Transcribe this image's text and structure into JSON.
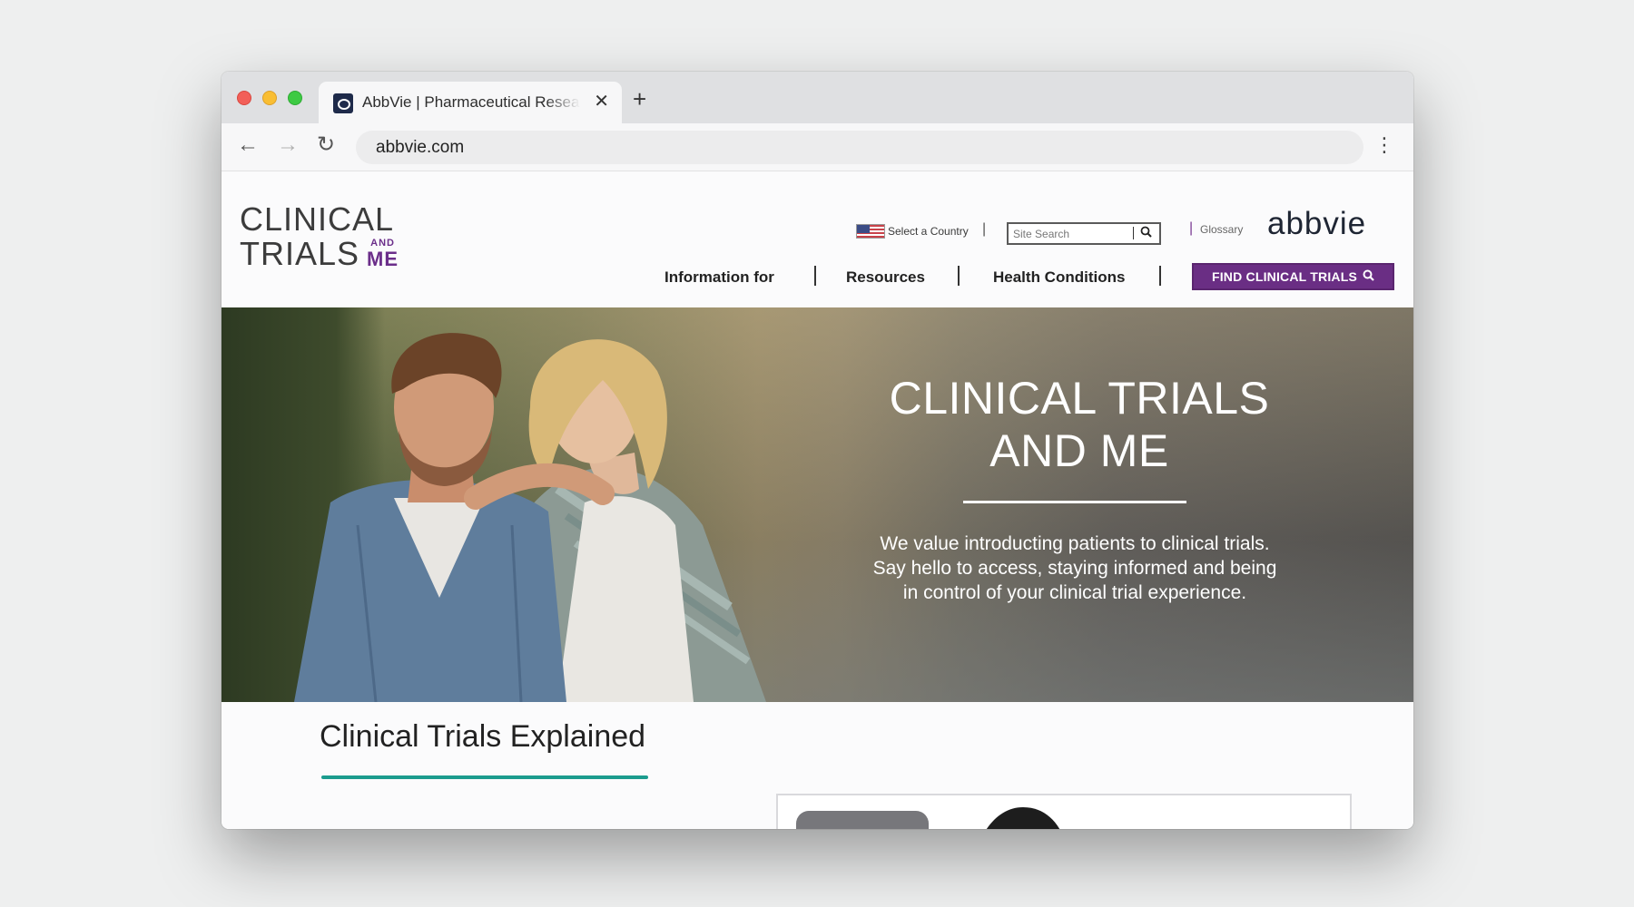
{
  "browser": {
    "tab_title": "AbbVie | Pharmaceutical Research",
    "tab_close": "✕",
    "new_tab": "+",
    "url": "abbvie.com",
    "back": "←",
    "forward": "→",
    "reload": "↻",
    "menu": "⋮"
  },
  "header": {
    "logo_line1": "CLINICAL",
    "logo_line2": "TRIALS",
    "logo_and": "AND",
    "logo_me": "ME",
    "country_label": "Select a Country",
    "search_placeholder": "Site Search",
    "glossary": "Glossary",
    "brand": "abbvie",
    "divider": "|"
  },
  "mainnav": {
    "items": [
      {
        "label": "Information for"
      },
      {
        "label": "Resources"
      },
      {
        "label": "Health Conditions"
      }
    ],
    "cta": "FIND CLINICAL TRIALS"
  },
  "hero": {
    "title_line1": "CLINICAL TRIALS",
    "title_line2": "AND ME",
    "body_line1": "We value introducting patients to clinical trials.",
    "body_line2": "Say hello to access, staying informed and being",
    "body_line3": "in control of your clinical trial experience."
  },
  "section": {
    "title": "Clinical Trials Explained"
  },
  "colors": {
    "brand_purple": "#6a2e84",
    "accent_teal": "#1b9c8e",
    "brand_navy": "#1e2533"
  }
}
